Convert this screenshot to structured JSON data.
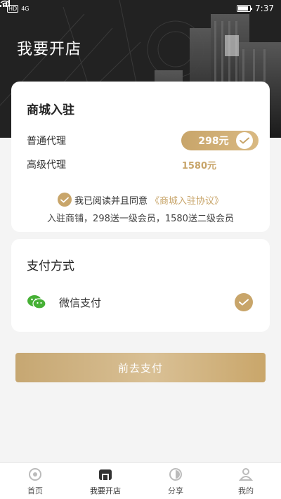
{
  "status": {
    "network_badge": "HD",
    "network_type": "4G",
    "time": "7:37"
  },
  "header": {
    "title": "我要开店"
  },
  "entry_card": {
    "title": "商城入驻",
    "plans": [
      {
        "label": "普通代理",
        "price": "298元",
        "selected": true
      },
      {
        "label": "高级代理",
        "price": "1580元",
        "selected": false
      }
    ],
    "agreement_text": "我已阅读并且同意",
    "agreement_link": "《商城入驻协议》",
    "note": "入驻商铺，298送一级会员，1580送二级会员"
  },
  "payment_card": {
    "title": "支付方式",
    "method_label": "微信支付",
    "method_icon": "wechat-icon"
  },
  "pay_button": {
    "label": "前去支付"
  },
  "tabbar": {
    "items": [
      {
        "label": "首页",
        "icon": "home-icon"
      },
      {
        "label": "我要开店",
        "icon": "shop-icon",
        "active": true
      },
      {
        "label": "分享",
        "icon": "share-icon"
      },
      {
        "label": "我的",
        "icon": "profile-icon"
      }
    ]
  },
  "colors": {
    "accent_gold": "#c8a56a",
    "header_dark": "#1f1f1f"
  }
}
